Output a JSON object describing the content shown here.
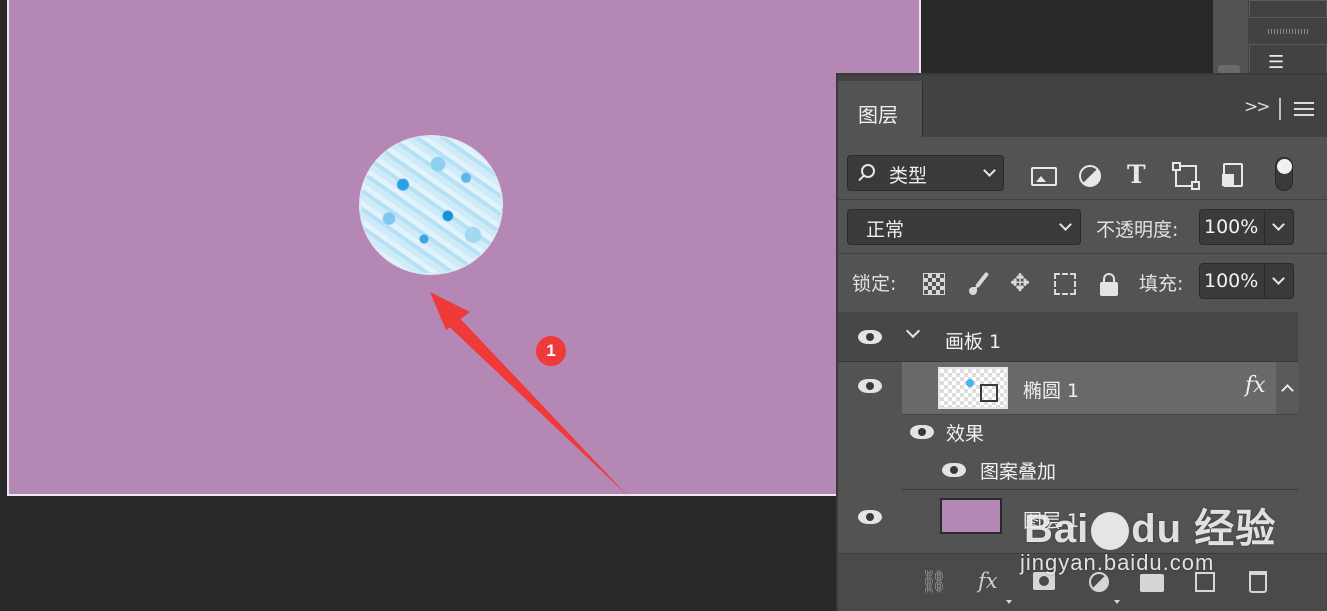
{
  "panel": {
    "tab_label": "图层",
    "collapse_symbol": ">>",
    "filter": {
      "kind_label": "类型"
    },
    "blend_mode": "正常",
    "opacity_label": "不透明度:",
    "opacity_value": "100%",
    "lock_label": "锁定:",
    "fill_label": "填充:",
    "fill_value": "100%"
  },
  "layers": {
    "artboard": {
      "name": "画板 1",
      "visible": true,
      "expanded": true
    },
    "ellipse": {
      "name": "椭圆 1",
      "visible": true,
      "has_fx": true,
      "fx_symbol": "fx"
    },
    "effects": {
      "label": "效果",
      "items": [
        {
          "name": "图案叠加",
          "visible": true
        }
      ]
    },
    "layer1": {
      "name": "图层 1",
      "visible": true
    }
  },
  "footer": {
    "fx_symbol": "fx"
  },
  "annotation": {
    "step_number": "1",
    "color": "#f03a3a"
  },
  "canvas": {
    "background_color": "#b587b5"
  },
  "watermark": {
    "line1_brand": "Bai",
    "line1_du": "du",
    "line1_cn": "经验",
    "line2": "jingyan.baidu.com"
  },
  "toolstrip": {
    "icon": "paragraph-style-icon"
  }
}
